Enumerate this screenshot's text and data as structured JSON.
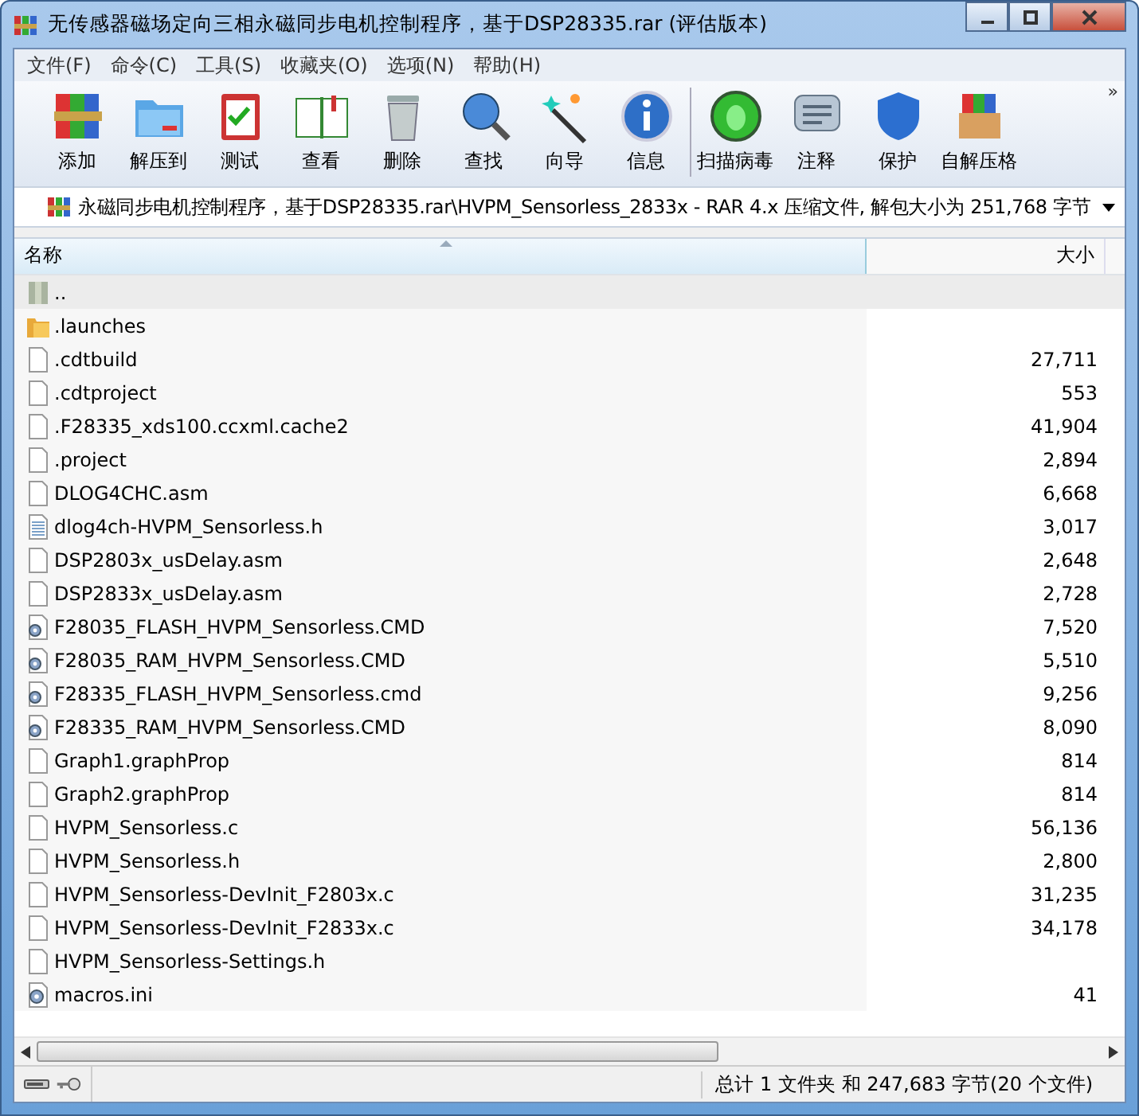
{
  "window": {
    "title": "无传感器磁场定向三相永磁同步电机控制程序，基于DSP28335.rar (评估版本)"
  },
  "menu": [
    "文件(F)",
    "命令(C)",
    "工具(S)",
    "收藏夹(O)",
    "选项(N)",
    "帮助(H)"
  ],
  "toolbar": [
    {
      "label": "添加",
      "kind": "add"
    },
    {
      "label": "解压到",
      "kind": "extract"
    },
    {
      "label": "测试",
      "kind": "test"
    },
    {
      "label": "查看",
      "kind": "view"
    },
    {
      "label": "删除",
      "kind": "delete"
    },
    {
      "label": "查找",
      "kind": "find"
    },
    {
      "label": "向导",
      "kind": "wizard"
    },
    {
      "label": "信息",
      "kind": "info"
    },
    {
      "label": "扫描病毒",
      "kind": "scan"
    },
    {
      "label": "注释",
      "kind": "comment"
    },
    {
      "label": "保护",
      "kind": "protect"
    },
    {
      "label": "自解压格",
      "kind": "sfx"
    }
  ],
  "toolbar_more": "»",
  "address": "永磁同步电机控制程序，基于DSP28335.rar\\HVPM_Sensorless_2833x - RAR 4.x 压缩文件, 解包大小为 251,768 字节",
  "columns": [
    {
      "label": "名称",
      "sorted": true
    },
    {
      "label": "大小",
      "sorted": false
    }
  ],
  "rows": [
    {
      "name": "..",
      "size": "",
      "kind": "parent",
      "selected": true
    },
    {
      "name": ".launches",
      "size": "",
      "kind": "folder",
      "selected": false
    },
    {
      "name": ".cdtbuild",
      "size": "27,711",
      "kind": "file",
      "selected": false
    },
    {
      "name": ".cdtproject",
      "size": "553",
      "kind": "file",
      "selected": false
    },
    {
      "name": ".F28335_xds100.ccxml.cache2",
      "size": "41,904",
      "kind": "file",
      "selected": false
    },
    {
      "name": ".project",
      "size": "2,894",
      "kind": "file",
      "selected": false
    },
    {
      "name": "DLOG4CHC.asm",
      "size": "6,668",
      "kind": "file",
      "selected": false
    },
    {
      "name": "dlog4ch-HVPM_Sensorless.h",
      "size": "3,017",
      "kind": "text",
      "selected": false
    },
    {
      "name": "DSP2803x_usDelay.asm",
      "size": "2,648",
      "kind": "file",
      "selected": false
    },
    {
      "name": "DSP2833x_usDelay.asm",
      "size": "2,728",
      "kind": "file",
      "selected": false
    },
    {
      "name": "F28035_FLASH_HVPM_Sensorless.CMD",
      "size": "7,520",
      "kind": "cmd",
      "selected": false
    },
    {
      "name": "F28035_RAM_HVPM_Sensorless.CMD",
      "size": "5,510",
      "kind": "cmd",
      "selected": false
    },
    {
      "name": "F28335_FLASH_HVPM_Sensorless.cmd",
      "size": "9,256",
      "kind": "cmd",
      "selected": false
    },
    {
      "name": "F28335_RAM_HVPM_Sensorless.CMD",
      "size": "8,090",
      "kind": "cmd",
      "selected": false
    },
    {
      "name": "Graph1.graphProp",
      "size": "814",
      "kind": "file",
      "selected": false
    },
    {
      "name": "Graph2.graphProp",
      "size": "814",
      "kind": "file",
      "selected": false
    },
    {
      "name": "HVPM_Sensorless.c",
      "size": "56,136",
      "kind": "file",
      "selected": false
    },
    {
      "name": "HVPM_Sensorless.h",
      "size": "2,800",
      "kind": "file",
      "selected": false
    },
    {
      "name": "HVPM_Sensorless-DevInit_F2803x.c",
      "size": "31,235",
      "kind": "file",
      "selected": false
    },
    {
      "name": "HVPM_Sensorless-DevInit_F2833x.c",
      "size": "34,178",
      "kind": "file",
      "selected": false
    },
    {
      "name": "HVPM_Sensorless-Settings.h",
      "size": "",
      "kind": "file",
      "selected": false
    },
    {
      "name": "macros.ini",
      "size": "41",
      "kind": "ini",
      "selected": false
    }
  ],
  "status": "总计 1 文件夹 和 247,683 字节(20 个文件)"
}
